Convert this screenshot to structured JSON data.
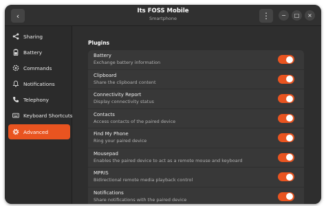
{
  "window": {
    "title": "Its FOSS Mobile",
    "subtitle": "Smartphone"
  },
  "header": {
    "back_icon": "‹",
    "menu_icon": "⋮",
    "minimize_icon": "−",
    "maximize_icon": "□",
    "close_icon": "×"
  },
  "sidebar": {
    "items": [
      {
        "label": "Sharing",
        "icon": "share-icon"
      },
      {
        "label": "Battery",
        "icon": "battery-icon"
      },
      {
        "label": "Commands",
        "icon": "command-icon"
      },
      {
        "label": "Notifications",
        "icon": "bell-icon"
      },
      {
        "label": "Telephony",
        "icon": "phone-icon"
      },
      {
        "label": "Keyboard Shortcuts",
        "icon": "keyboard-icon"
      },
      {
        "label": "Advanced",
        "icon": "gear-icon",
        "active": true
      }
    ]
  },
  "main": {
    "section_title": "Plugins",
    "plugins": [
      {
        "title": "Battery",
        "subtitle": "Exchange battery information",
        "enabled": true
      },
      {
        "title": "Clipboard",
        "subtitle": "Share the clipboard content",
        "enabled": true
      },
      {
        "title": "Connectivity Report",
        "subtitle": "Display connectivity status",
        "enabled": true
      },
      {
        "title": "Contacts",
        "subtitle": "Access contacts of the paired device",
        "enabled": true
      },
      {
        "title": "Find My Phone",
        "subtitle": "Ring your paired device",
        "enabled": true
      },
      {
        "title": "Mousepad",
        "subtitle": "Enables the paired device to act as a remote mouse and keyboard",
        "enabled": true
      },
      {
        "title": "MPRIS",
        "subtitle": "Bidirectional remote media playback control",
        "enabled": true
      },
      {
        "title": "Notifications",
        "subtitle": "Share notifications with the paired device",
        "enabled": true
      }
    ]
  },
  "colors": {
    "accent": "#e95420",
    "window_bg": "#2e2e2e",
    "sidebar_bg": "#2b2b2b",
    "list_bg": "#383838"
  }
}
